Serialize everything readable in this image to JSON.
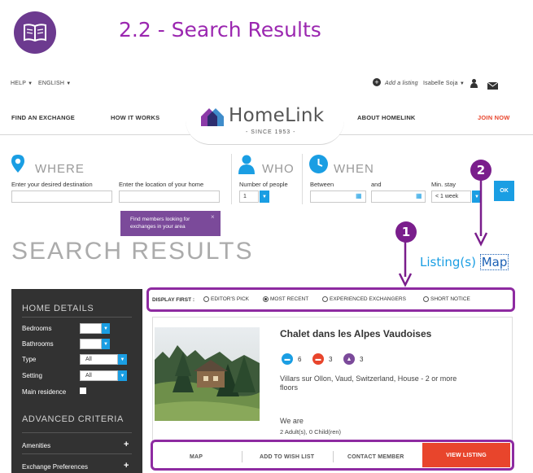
{
  "slide": {
    "title": "2.2 - Search Results",
    "icon": "open-book-icon"
  },
  "utility_bar": {
    "help": "HELP",
    "language": "ENGLISH",
    "add_listing": "Add a listing",
    "user_name": "Isabelle Soja"
  },
  "nav": {
    "find_exchange": "FIND AN EXCHANGE",
    "how_it_works": "HOW IT WORKS",
    "logo_name": "HomeLink",
    "logo_since": "- SINCE 1953 -",
    "about": "ABOUT HOMELINK",
    "join": "JOIN NOW"
  },
  "search_form": {
    "where": {
      "heading": "WHERE",
      "destination_label": "Enter your desired destination",
      "home_label": "Enter the location of your home"
    },
    "who": {
      "heading": "WHO",
      "people_label": "Number of people",
      "people_value": "1"
    },
    "when": {
      "heading": "WHEN",
      "between_label": "Between",
      "and_label": "and",
      "min_stay_label": "Min. stay",
      "min_stay_value": "< 1 week"
    },
    "ok_label": "OK",
    "tooltip": {
      "line1": "Find members looking for",
      "line2": "exchanges in your area"
    }
  },
  "results": {
    "title": "SEARCH RESULTS",
    "listing_toggle": "Listing(s)",
    "map_toggle": "Map"
  },
  "annotations": {
    "one": "1",
    "two": "2"
  },
  "sidebar": {
    "home_details": "HOME DETAILS",
    "bedrooms": "Bedrooms",
    "bathrooms": "Bathrooms",
    "type": "Type",
    "type_value": "All",
    "setting": "Setting",
    "setting_value": "All",
    "main_residence": "Main residence",
    "advanced": "ADVANCED CRITERIA",
    "amenities": "Amenities",
    "exchange_prefs": "Exchange Preferences"
  },
  "display_first": {
    "label": "DISPLAY FIRST :",
    "options": [
      "EDITOR'S PICK",
      "MOST RECENT",
      "EXPERIENCED EXCHANGERS",
      "SHORT NOTICE"
    ],
    "selected": "MOST RECENT"
  },
  "listing": {
    "title": "Chalet dans les Alpes Vaudoises",
    "beds": "6",
    "bedrooms": "3",
    "bathrooms": "3",
    "location_line1": "Villars sur Ollon, Vaud, Switzerland, House - 2 or more",
    "location_line2": "floors",
    "we_are": "We are",
    "household": "2 Adult(s), 0 Child(ren)"
  },
  "actions": {
    "map": "MAP",
    "wish_list": "ADD TO WISH LIST",
    "contact": "CONTACT MEMBER",
    "view": "VIEW LISTING"
  },
  "colors": {
    "purple": "#9b27b0",
    "annotation": "#8e2ba1",
    "blue": "#1a9ee3",
    "orange": "#e8452c",
    "sidebar_bg": "#323232"
  }
}
